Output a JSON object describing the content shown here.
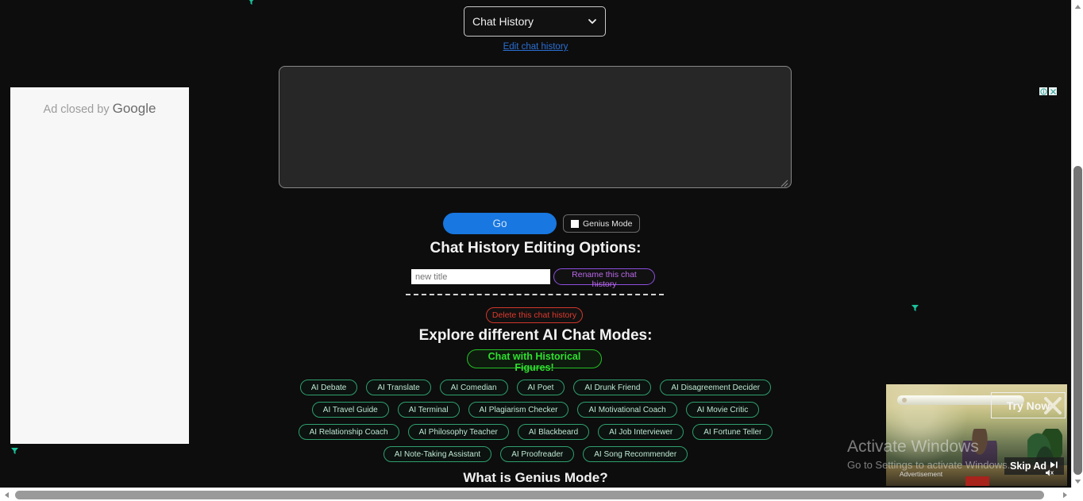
{
  "select": {
    "selected": "Chat History",
    "options": [
      "Chat History"
    ],
    "icon": "chevron-down-icon"
  },
  "edit_link": {
    "label": "Edit chat history"
  },
  "textarea": {
    "value": "",
    "placeholder": ""
  },
  "actions": {
    "go_label": "Go",
    "genius_mode_label": "Genius Mode",
    "genius_mode_checked": false
  },
  "headings": {
    "editing_options": "Chat History Editing Options:",
    "explore_modes": "Explore different AI Chat Modes:",
    "what_is_genius": "What is Genius Mode?"
  },
  "rename": {
    "input_value": "",
    "input_placeholder": "new title",
    "button_label": "Rename this chat history"
  },
  "delete": {
    "button_label": "Delete this chat history"
  },
  "historical": {
    "button_label": "Chat with Historical Figures!"
  },
  "modes": {
    "rows": [
      [
        "AI Debate",
        "AI Translate",
        "AI Comedian",
        "AI Poet",
        "AI Drunk Friend",
        "AI Disagreement Decider"
      ],
      [
        "AI Travel Guide",
        "AI Terminal",
        "AI Plagiarism Checker",
        "AI Motivational Coach",
        "AI Movie Critic"
      ],
      [
        "AI Relationship Coach",
        "AI Philosophy Teacher",
        "AI Blackbeard",
        "AI Job Interviewer",
        "AI Fortune Teller"
      ],
      [
        "AI Note-Taking Assistant",
        "AI Proofreader",
        "AI Song Recommender"
      ]
    ]
  },
  "ad_left": {
    "text_prefix": "Ad closed by ",
    "brand": "Google"
  },
  "ad_controls": {
    "info_icon": "info-icon",
    "close_icon": "close-icon"
  },
  "video_ad": {
    "try_now_label": "Try Now",
    "skip_ad_label": "Skip Ad",
    "skip_ad_icon": "skip-next-icon",
    "advertisement_label": "Advertisement",
    "mute_icon": "speaker-mute-icon",
    "close_icon": "close-x-icon"
  },
  "watermark": {
    "title": "Activate Windows",
    "subtitle": "Go to Settings to activate Windows."
  },
  "colors": {
    "page_background": "#0d0d0d",
    "go_button": "#1877e0",
    "link_blue": "#2b6fd6",
    "pill_border": "#2f9e6e",
    "pill_text": "#bfe8d4",
    "historical_green": "#2ee02e",
    "rename_purple": "#b968e8",
    "delete_red": "#e0392e",
    "glyph_teal": "#19c39a"
  },
  "scrollbars": {
    "vertical_up_icon": "triangle-up-icon",
    "vertical_down_icon": "triangle-down-icon",
    "horizontal_left_icon": "triangle-left-icon",
    "horizontal_right_icon": "triangle-right-icon"
  }
}
